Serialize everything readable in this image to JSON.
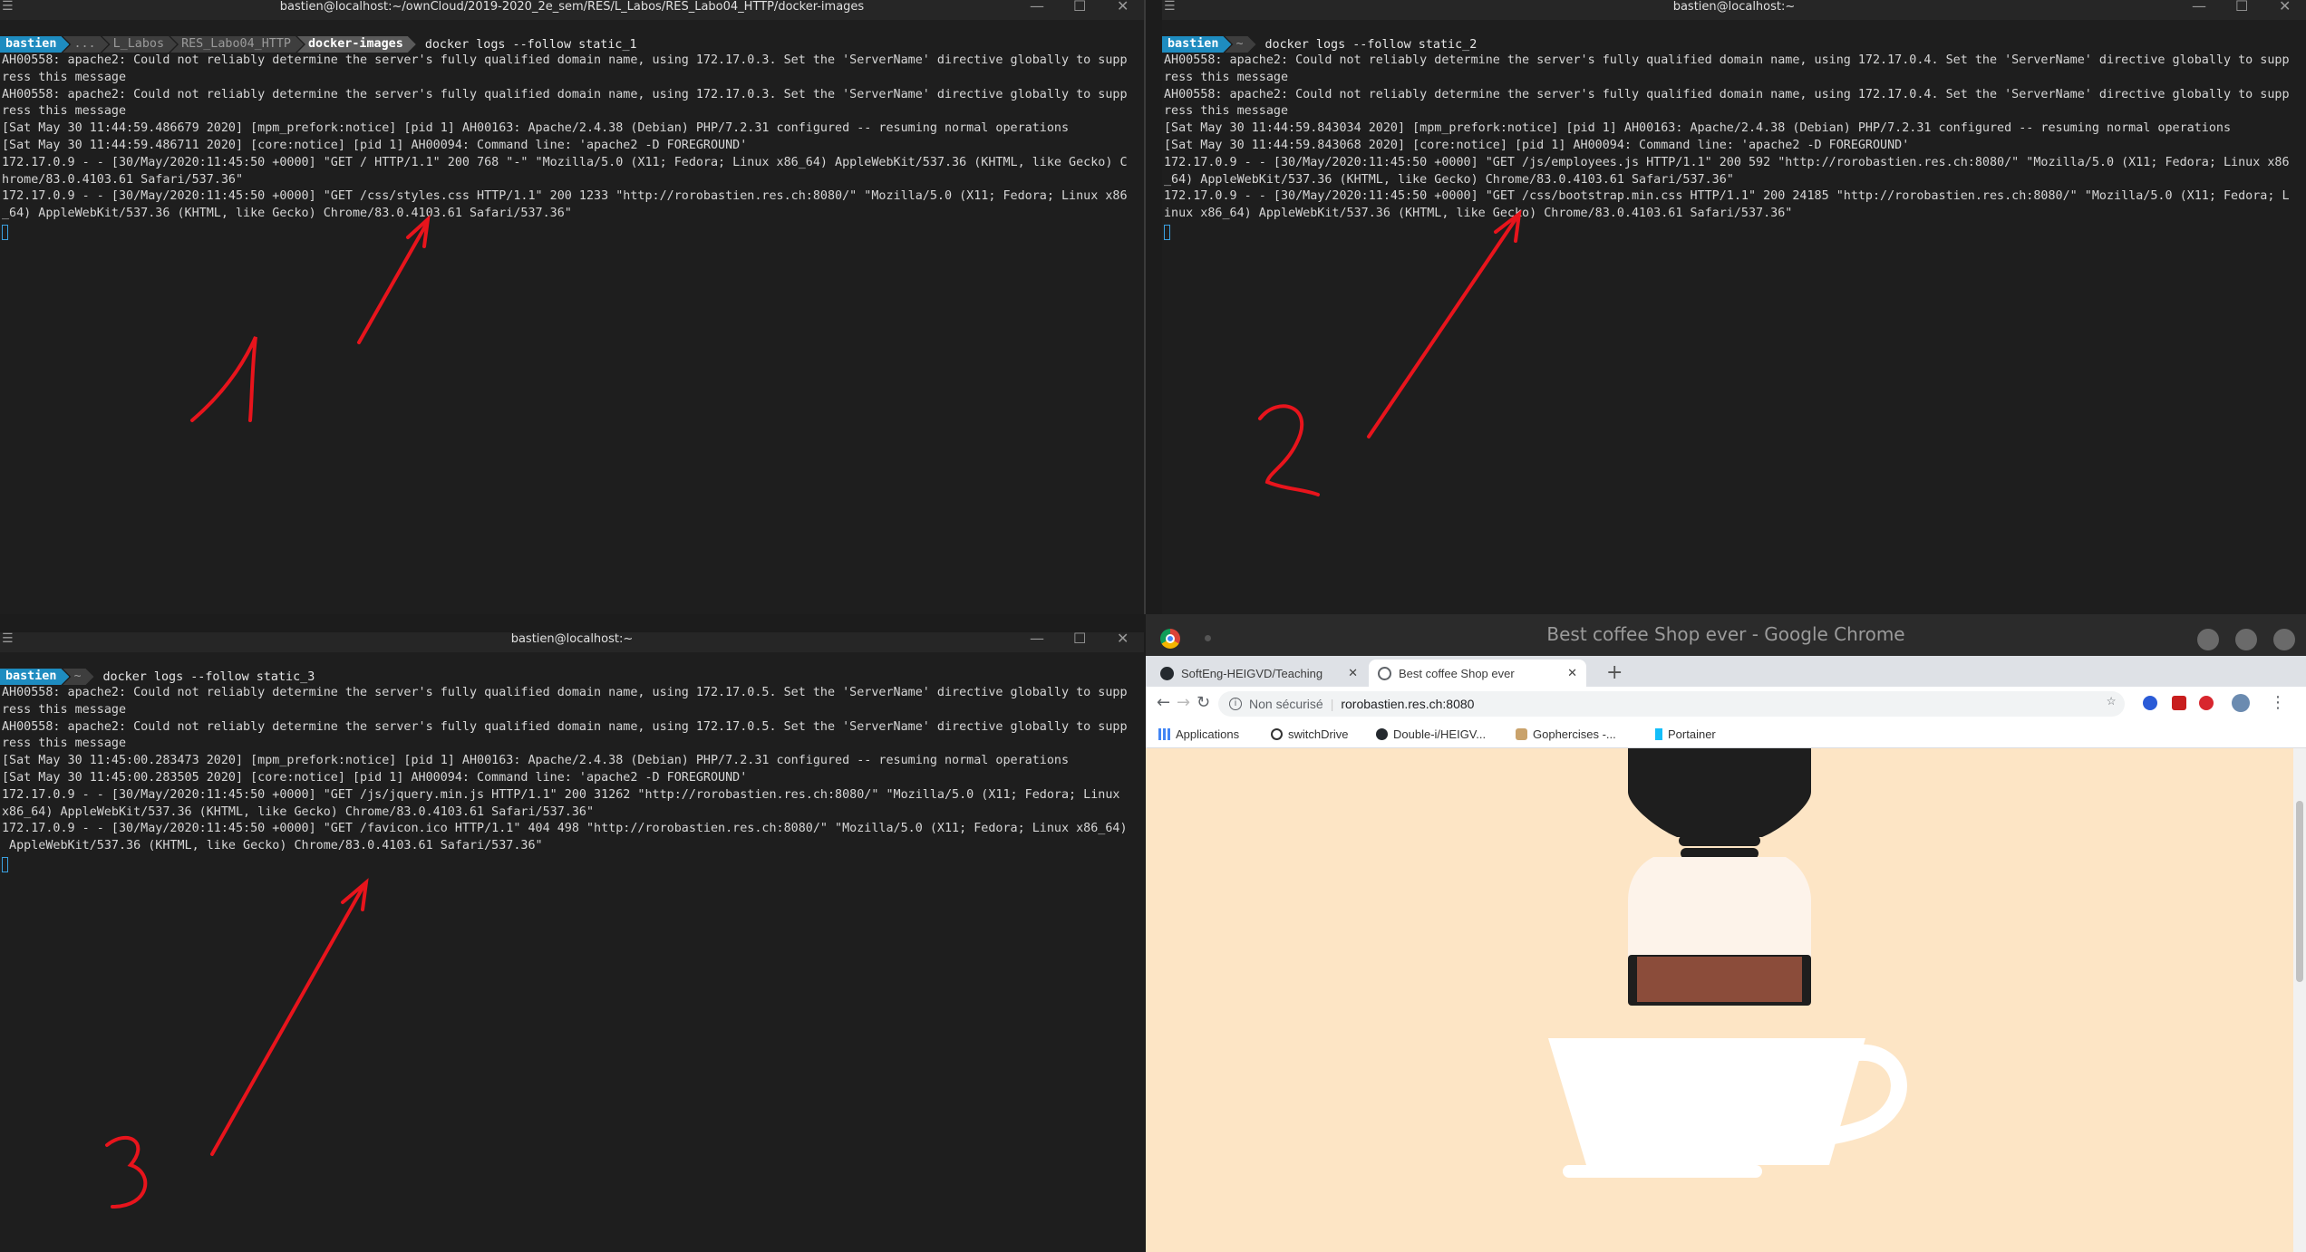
{
  "terminals": [
    {
      "title": "bastien@localhost:~/ownCloud/2019-2020_2e_sem/RES/L_Labos/RES_Labo04_HTTP/docker-images",
      "prompt_user": "bastien",
      "prompt_path": [
        "...",
        "L_Labos",
        "RES_Labo04_HTTP"
      ],
      "prompt_current": "docker-images",
      "command": "docker logs --follow static_1",
      "lines": [
        "AH00558: apache2: Could not reliably determine the server's fully qualified domain name, using 172.17.0.3. Set the 'ServerName' directive globally to supp",
        "ress this message",
        "AH00558: apache2: Could not reliably determine the server's fully qualified domain name, using 172.17.0.3. Set the 'ServerName' directive globally to supp",
        "ress this message",
        "[Sat May 30 11:44:59.486679 2020] [mpm_prefork:notice] [pid 1] AH00163: Apache/2.4.38 (Debian) PHP/7.2.31 configured -- resuming normal operations",
        "[Sat May 30 11:44:59.486711 2020] [core:notice] [pid 1] AH00094: Command line: 'apache2 -D FOREGROUND'",
        "172.17.0.9 - - [30/May/2020:11:45:50 +0000] \"GET / HTTP/1.1\" 200 768 \"-\" \"Mozilla/5.0 (X11; Fedora; Linux x86_64) AppleWebKit/537.36 (KHTML, like Gecko) C",
        "hrome/83.0.4103.61 Safari/537.36\"",
        "172.17.0.9 - - [30/May/2020:11:45:50 +0000] \"GET /css/styles.css HTTP/1.1\" 200 1233 \"http://rorobastien.res.ch:8080/\" \"Mozilla/5.0 (X11; Fedora; Linux x86",
        "_64) AppleWebKit/537.36 (KHTML, like Gecko) Chrome/83.0.4103.61 Safari/537.36\""
      ]
    },
    {
      "title": "bastien@localhost:~",
      "prompt_user": "bastien",
      "prompt_path": [
        "~"
      ],
      "prompt_current": "",
      "command": "docker logs --follow static_2",
      "lines": [
        "AH00558: apache2: Could not reliably determine the server's fully qualified domain name, using 172.17.0.4. Set the 'ServerName' directive globally to supp",
        "ress this message",
        "AH00558: apache2: Could not reliably determine the server's fully qualified domain name, using 172.17.0.4. Set the 'ServerName' directive globally to supp",
        "ress this message",
        "[Sat May 30 11:44:59.843034 2020] [mpm_prefork:notice] [pid 1] AH00163: Apache/2.4.38 (Debian) PHP/7.2.31 configured -- resuming normal operations",
        "[Sat May 30 11:44:59.843068 2020] [core:notice] [pid 1] AH00094: Command line: 'apache2 -D FOREGROUND'",
        "172.17.0.9 - - [30/May/2020:11:45:50 +0000] \"GET /js/employees.js HTTP/1.1\" 200 592 \"http://rorobastien.res.ch:8080/\" \"Mozilla/5.0 (X11; Fedora; Linux x86",
        "_64) AppleWebKit/537.36 (KHTML, like Gecko) Chrome/83.0.4103.61 Safari/537.36\"",
        "172.17.0.9 - - [30/May/2020:11:45:50 +0000] \"GET /css/bootstrap.min.css HTTP/1.1\" 200 24185 \"http://rorobastien.res.ch:8080/\" \"Mozilla/5.0 (X11; Fedora; L",
        "inux x86_64) AppleWebKit/537.36 (KHTML, like Gecko) Chrome/83.0.4103.61 Safari/537.36\""
      ]
    },
    {
      "title": "bastien@localhost:~",
      "prompt_user": "bastien",
      "prompt_path": [
        "~"
      ],
      "prompt_current": "",
      "command": "docker logs --follow static_3",
      "lines": [
        "AH00558: apache2: Could not reliably determine the server's fully qualified domain name, using 172.17.0.5. Set the 'ServerName' directive globally to supp",
        "ress this message",
        "AH00558: apache2: Could not reliably determine the server's fully qualified domain name, using 172.17.0.5. Set the 'ServerName' directive globally to supp",
        "ress this message",
        "[Sat May 30 11:45:00.283473 2020] [mpm_prefork:notice] [pid 1] AH00163: Apache/2.4.38 (Debian) PHP/7.2.31 configured -- resuming normal operations",
        "[Sat May 30 11:45:00.283505 2020] [core:notice] [pid 1] AH00094: Command line: 'apache2 -D FOREGROUND'",
        "172.17.0.9 - - [30/May/2020:11:45:50 +0000] \"GET /js/jquery.min.js HTTP/1.1\" 200 31262 \"http://rorobastien.res.ch:8080/\" \"Mozilla/5.0 (X11; Fedora; Linux",
        "x86_64) AppleWebKit/537.36 (KHTML, like Gecko) Chrome/83.0.4103.61 Safari/537.36\"",
        "172.17.0.9 - - [30/May/2020:11:45:50 +0000] \"GET /favicon.ico HTTP/1.1\" 404 498 \"http://rorobastien.res.ch:8080/\" \"Mozilla/5.0 (X11; Fedora; Linux x86_64)",
        " AppleWebKit/537.36 (KHTML, like Gecko) Chrome/83.0.4103.61 Safari/537.36\""
      ]
    }
  ],
  "annotations": [
    "1",
    "2",
    "3"
  ],
  "annotation_color": "#e8141c",
  "browser": {
    "window_title": "Best coffee Shop ever - Google Chrome",
    "tabs": [
      {
        "label": "SoftEng-HEIGVD/Teaching",
        "active": false
      },
      {
        "label": "Best coffee Shop ever",
        "active": true
      }
    ],
    "address": {
      "security": "Non sécurisé",
      "url": "rorobastien.res.ch:8080"
    },
    "bookmarks": [
      "Applications",
      "switchDrive",
      "Double-i/HEIGV...",
      "Gophercises -...",
      "Portainer"
    ],
    "page_background": "#fde5c5"
  }
}
